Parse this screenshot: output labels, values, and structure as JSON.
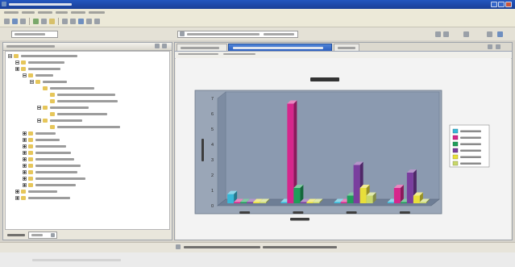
{
  "colors": {
    "titlebar": "#1a3f96",
    "selected_tab": "#2c5fbf",
    "plot_background": "#9aa6b7",
    "back_wall": "#8b9ab0"
  },
  "icons": {
    "window_controls": [
      "minimize-icon",
      "maximize-icon",
      "close-icon"
    ],
    "tree_expand": "plus-box-icon",
    "tree_collapse": "minus-box-icon",
    "tree_node": "folder-icon"
  },
  "chart_data": {
    "type": "bar",
    "style": "3d-clustered",
    "ylim": [
      0,
      7
    ],
    "yticks": [
      0,
      1,
      2,
      3,
      4,
      5,
      6,
      7
    ],
    "grid": false,
    "legend": "right",
    "category_count": 4,
    "series": [
      {
        "color": "#37b8d8",
        "values": [
          0.6,
          0,
          0,
          0
        ]
      },
      {
        "color": "#d6268c",
        "values": [
          0,
          6.5,
          0,
          1.0
        ]
      },
      {
        "color": "#1f9e5a",
        "values": [
          0,
          1.0,
          0.5,
          0
        ]
      },
      {
        "color": "#7a3e9e",
        "values": [
          0,
          0,
          2.5,
          2.0
        ]
      },
      {
        "color": "#e8df3a",
        "values": [
          0,
          0,
          1.0,
          0.5
        ]
      },
      {
        "color": "#c9d86a",
        "values": [
          0,
          0,
          0.5,
          0
        ]
      }
    ]
  }
}
